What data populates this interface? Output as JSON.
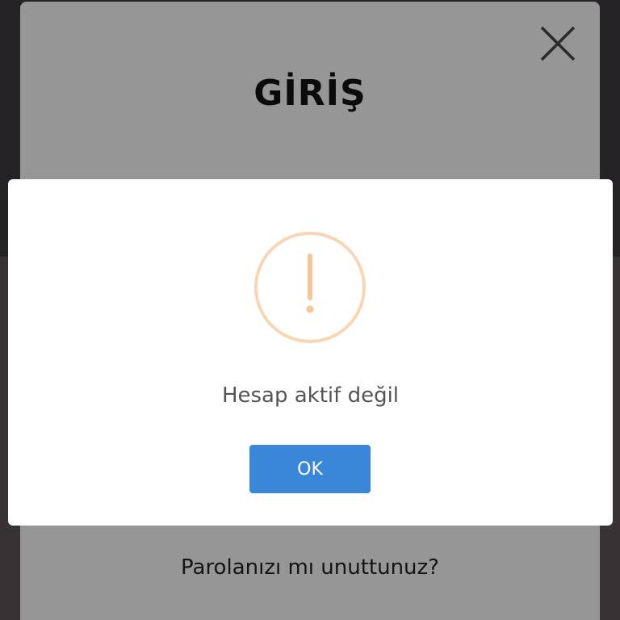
{
  "login_modal": {
    "title": "GİRİŞ",
    "close_icon": "close-icon",
    "forgot_password": "Parolanızı mı unuttunuz?"
  },
  "alert": {
    "icon": "warning-icon",
    "icon_color": "#f8bb86",
    "message": "Hesap aktif değil",
    "ok_label": "OK",
    "ok_color": "#3a87d9"
  }
}
